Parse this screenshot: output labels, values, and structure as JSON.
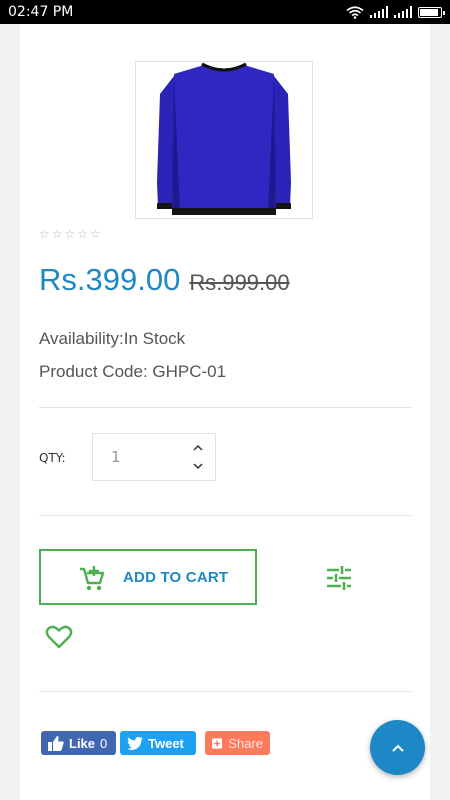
{
  "status_bar": {
    "time": "02:47 PM"
  },
  "product": {
    "image_alt": "blue long sleeve t-shirt",
    "rating_stars": 5,
    "rating_filled": 0,
    "price": "Rs.399.00",
    "old_price": "Rs.999.00",
    "availability": "Availability:In Stock",
    "product_code": "Product Code: GHPC-01"
  },
  "qty": {
    "label": "QTY:",
    "value": "1"
  },
  "actions": {
    "add_to_cart": "ADD TO CART",
    "compare_icon": "sliders-icon",
    "wishlist_icon": "heart-icon"
  },
  "social": {
    "like_label": "Like",
    "like_count": "0",
    "tweet_label": "Tweet",
    "share_label": "Share"
  },
  "colors": {
    "accent_blue": "#1e88c7",
    "green": "#4caf50",
    "facebook": "#4267b2",
    "twitter": "#1da1f2",
    "share": "#ff7a5c",
    "shirt": "#2b22b8"
  }
}
